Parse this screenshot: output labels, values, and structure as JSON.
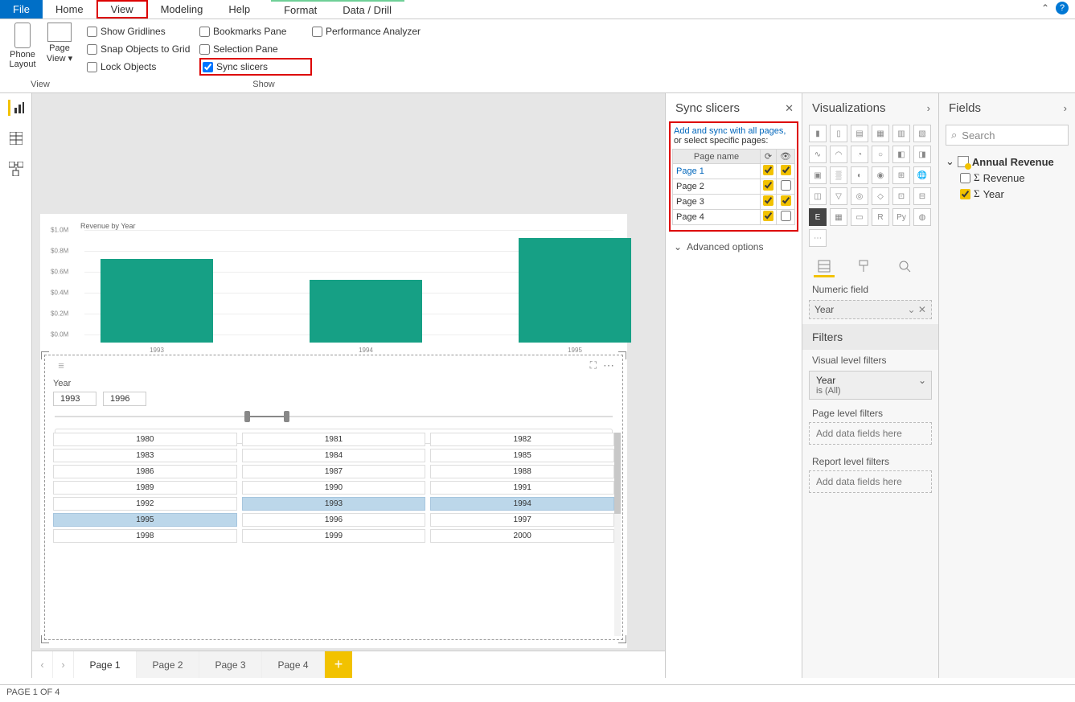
{
  "ribbon": {
    "tabs": [
      "File",
      "Home",
      "View",
      "Modeling",
      "Help"
    ],
    "context_tabs": [
      "Format",
      "Data / Drill"
    ],
    "view_group": {
      "phone": "Phone Layout",
      "page": "Page View",
      "group_label": "View"
    },
    "checks": {
      "show_gridlines": "Show Gridlines",
      "snap": "Snap Objects to Grid",
      "lock": "Lock Objects",
      "bookmarks": "Bookmarks Pane",
      "selection": "Selection Pane",
      "sync": "Sync slicers",
      "perf": "Performance Analyzer",
      "group_label": "Show"
    }
  },
  "sync_pane": {
    "title": "Sync slicers",
    "hint_link": "Add and sync with all pages",
    "hint_text": "or select specific pages:",
    "col_page": "Page name",
    "rows": [
      {
        "name": "Page 1",
        "sync": true,
        "visible": true,
        "active": true
      },
      {
        "name": "Page 2",
        "sync": true,
        "visible": false
      },
      {
        "name": "Page 3",
        "sync": true,
        "visible": true
      },
      {
        "name": "Page 4",
        "sync": true,
        "visible": false
      }
    ],
    "advanced": "Advanced options"
  },
  "viz_pane": {
    "title": "Visualizations",
    "numeric_label": "Numeric field",
    "numeric_value": "Year",
    "filters": "Filters",
    "vlf": "Visual level filters",
    "vlf_field": "Year",
    "vlf_cond": "is (All)",
    "plf": "Page level filters",
    "rlf": "Report level filters",
    "drop": "Add data fields here"
  },
  "fields_pane": {
    "title": "Fields",
    "search": "Search",
    "table": "Annual Revenue",
    "f_revenue": "Revenue",
    "f_year": "Year"
  },
  "chart_data": {
    "type": "bar",
    "title": "Revenue by Year",
    "ylabel": "",
    "categories": [
      "1993",
      "1994",
      "1995"
    ],
    "values": [
      800000,
      600000,
      1000000
    ],
    "ylim": [
      0,
      1000000
    ],
    "yticks": [
      "$0.0M",
      "$0.2M",
      "$0.4M",
      "$0.6M",
      "$0.8M",
      "$1.0M"
    ]
  },
  "slicer": {
    "field": "Year",
    "from": "1993",
    "to": "1996",
    "years_grid": [
      [
        "1980",
        "1981",
        "1982"
      ],
      [
        "1983",
        "1984",
        "1985"
      ],
      [
        "1986",
        "1987",
        "1988"
      ],
      [
        "1989",
        "1990",
        "1991"
      ],
      [
        "1992",
        "1993",
        "1994"
      ],
      [
        "1995",
        "1996",
        "1997"
      ],
      [
        "1998",
        "1999",
        "2000"
      ]
    ],
    "selected": [
      "1993",
      "1994",
      "1995"
    ]
  },
  "page_tabs": {
    "pages": [
      "Page 1",
      "Page 2",
      "Page 3",
      "Page 4"
    ],
    "active": 0
  },
  "status": "PAGE 1 OF 4"
}
